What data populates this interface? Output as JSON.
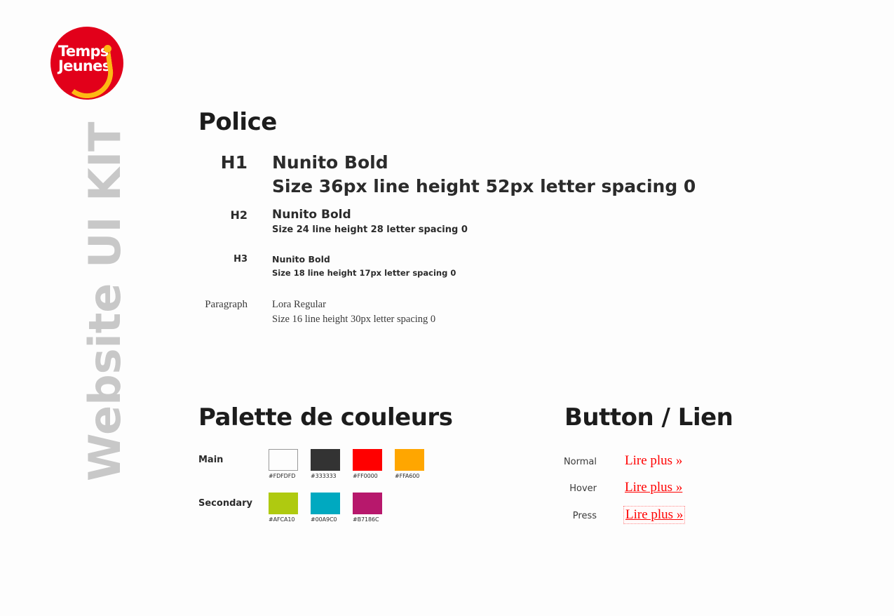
{
  "side_title": "Website UI KIT",
  "logo": {
    "line1": "Temps",
    "line2": "Jeunes",
    "circle_color": "#E2001A",
    "accent_color": "#FDB913"
  },
  "typography": {
    "heading": "Police",
    "rows": [
      {
        "label": "H1",
        "font_name": "Nunito Bold",
        "spec": "Size 36px  line height 52px  letter spacing 0"
      },
      {
        "label": "H2",
        "font_name": "Nunito Bold",
        "spec": "Size 24  line height 28  letter spacing 0"
      },
      {
        "label": "H3",
        "font_name": "Nunito Bold",
        "spec": "Size 18  line height 17px  letter spacing 0"
      },
      {
        "label": "Paragraph",
        "font_name": "Lora Regular",
        "spec": "Size 16  line height 30px  letter spacing 0"
      }
    ]
  },
  "palette": {
    "heading": "Palette de couleurs",
    "rows": [
      {
        "label": "Main",
        "swatches": [
          {
            "hex": "#FDFDFD",
            "bordered": true
          },
          {
            "hex": "#333333",
            "bordered": false
          },
          {
            "hex": "#FF0000",
            "bordered": false
          },
          {
            "hex": "#FFA600",
            "bordered": false
          }
        ]
      },
      {
        "label": "Secondary",
        "swatches": [
          {
            "hex": "#AFCA10",
            "bordered": false
          },
          {
            "hex": "#00A9C0",
            "bordered": false
          },
          {
            "hex": "#B7186C",
            "bordered": false
          }
        ]
      }
    ]
  },
  "buttons": {
    "heading": "Button / Lien",
    "link_color": "#FF0000",
    "states": [
      {
        "label": "Normal",
        "link": "Lire plus »"
      },
      {
        "label": "Hover",
        "link": "Lire plus »"
      },
      {
        "label": "Press",
        "link": "Lire plus »"
      }
    ]
  }
}
